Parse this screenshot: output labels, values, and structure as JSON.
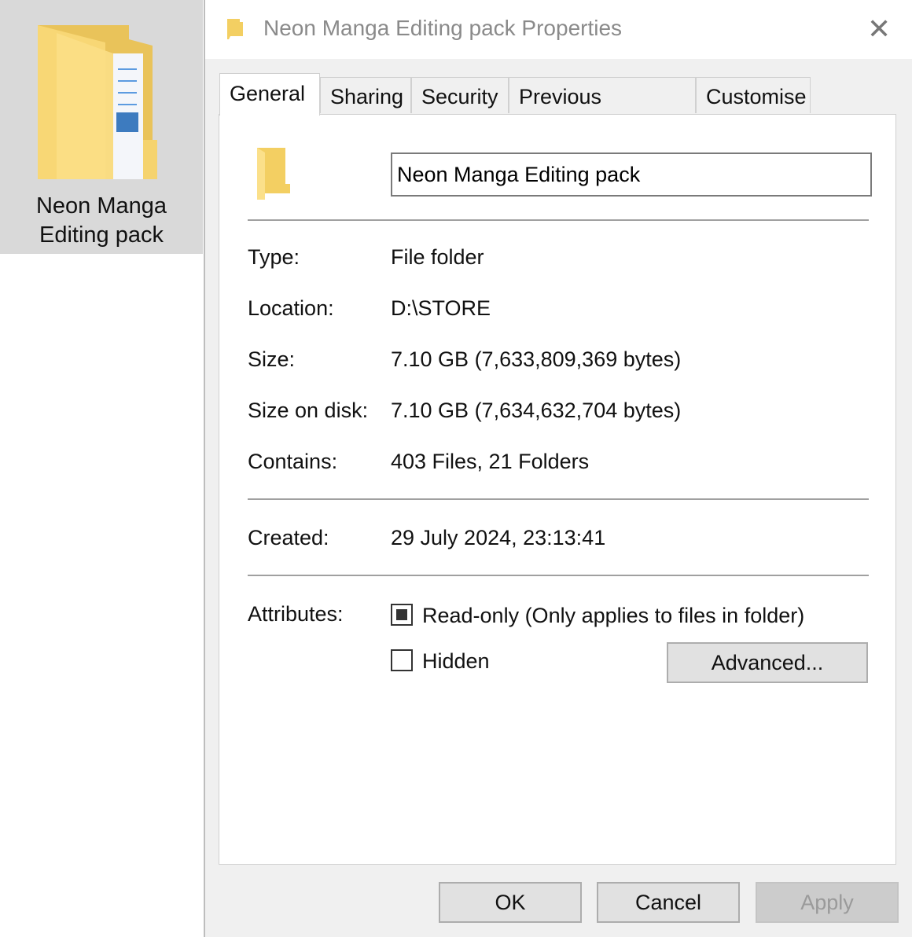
{
  "desktop": {
    "item_label_line1": "Neon Manga",
    "item_label_line2": "Editing pack"
  },
  "dialog": {
    "title": "Neon Manga Editing pack Properties",
    "tabs": [
      {
        "label": "General",
        "active": true
      },
      {
        "label": "Sharing"
      },
      {
        "label": "Security"
      },
      {
        "label": "Previous Versions"
      },
      {
        "label": "Customise"
      }
    ],
    "name_value": "Neon Manga Editing pack",
    "properties": [
      {
        "label": "Type:",
        "value": "File folder"
      },
      {
        "label": "Location:",
        "value": "D:\\STORE"
      },
      {
        "label": "Size:",
        "value": "7.10 GB (7,633,809,369 bytes)"
      },
      {
        "label": "Size on disk:",
        "value": "7.10 GB (7,634,632,704 bytes)"
      },
      {
        "label": "Contains:",
        "value": "403 Files, 21 Folders"
      }
    ],
    "created": {
      "label": "Created:",
      "value": "29 July 2024, 23:13:41"
    },
    "attributes": {
      "label": "Attributes:",
      "readonly_label": "Read-only (Only applies to files in folder)",
      "readonly_state": "indeterminate",
      "hidden_label": "Hidden",
      "hidden_checked": false,
      "advanced_label": "Advanced..."
    },
    "buttons": {
      "ok": "OK",
      "cancel": "Cancel",
      "apply": "Apply"
    }
  },
  "colors": {
    "folder": "#f8d775",
    "dialog_bg": "#f0f0f0",
    "selection": "#d9d9d9"
  }
}
